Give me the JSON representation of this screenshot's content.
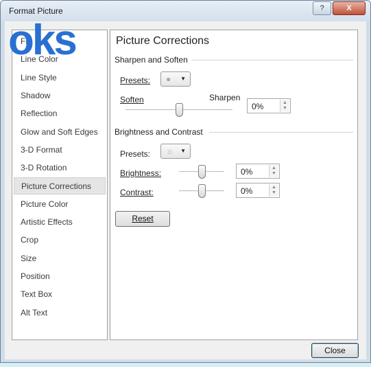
{
  "window": {
    "title": "Format Picture",
    "help_label": "?",
    "close_label": "X"
  },
  "watermark": {
    "text": "oks"
  },
  "sidebar": {
    "items": [
      {
        "label": "Fill"
      },
      {
        "label": "Line Color"
      },
      {
        "label": "Line Style"
      },
      {
        "label": "Shadow"
      },
      {
        "label": "Reflection"
      },
      {
        "label": "Glow and Soft Edges"
      },
      {
        "label": "3-D Format"
      },
      {
        "label": "3-D Rotation"
      },
      {
        "label": "Picture Corrections",
        "selected": true
      },
      {
        "label": "Picture Color"
      },
      {
        "label": "Artistic Effects"
      },
      {
        "label": "Crop"
      },
      {
        "label": "Size"
      },
      {
        "label": "Position"
      },
      {
        "label": "Text Box"
      },
      {
        "label": "Alt Text"
      }
    ]
  },
  "panel": {
    "title": "Picture Corrections",
    "sharpen": {
      "group_label": "Sharpen and Soften",
      "presets_label": "Presets:",
      "soften_label": "Soften",
      "sharpen_label": "Sharpen",
      "value": "0%",
      "level": 0.5
    },
    "brightness": {
      "group_label": "Brightness and Contrast",
      "presets_label": "Presets:",
      "brightness_label": "Brightness:",
      "brightness_value": "0%",
      "brightness_level": 0.5,
      "contrast_label": "Contrast:",
      "contrast_value": "0%",
      "contrast_level": 0.5
    },
    "reset_label": "Reset"
  },
  "footer": {
    "close_label": "Close"
  },
  "colors": {
    "watermark": "#2a6fd2",
    "selected_item_bg": "#e5e5e5",
    "title_bar": "#d3dfec",
    "close_glyph_bg": "#c1513a"
  },
  "icons": [
    "help-icon",
    "window-close-icon",
    "sharpen-preset-icon",
    "brightness-preset-icon",
    "dropdown-arrow-icon",
    "spin-up-icon",
    "spin-down-icon"
  ]
}
